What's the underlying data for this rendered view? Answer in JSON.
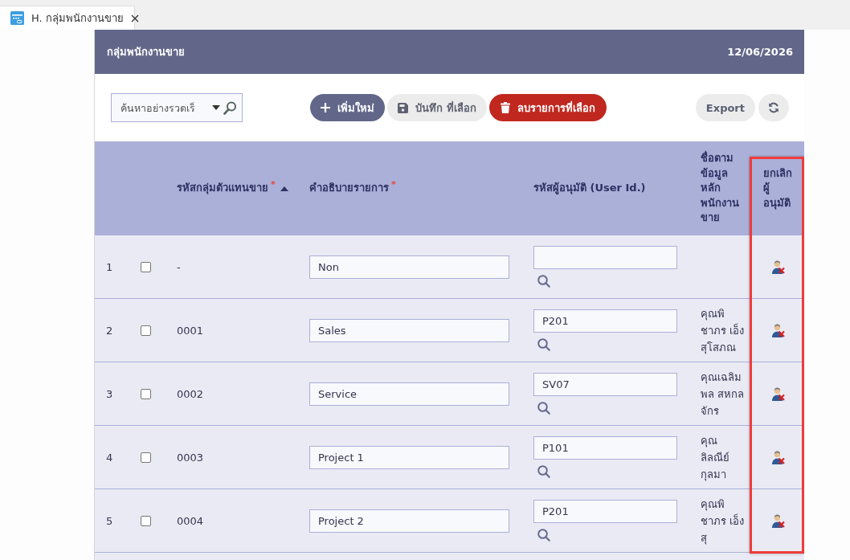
{
  "tab": {
    "label": "H. กลุ่มพนักงานขาย"
  },
  "panel": {
    "title": "กลุ่มพนักงานขาย",
    "date": "12/06/2026"
  },
  "toolbar": {
    "quick_search": {
      "placeholder": "ค้นหาอย่างรวดเร็"
    },
    "actions": [
      {
        "kind": "add",
        "label": "เพิ่มใหม่"
      },
      {
        "kind": "save",
        "label": "บันทึก ที่เลือก"
      },
      {
        "kind": "delete",
        "label": "ลบรายการที่เลือก"
      }
    ],
    "tools": [
      {
        "kind": "export",
        "label": "Export"
      },
      {
        "kind": "refresh"
      }
    ]
  },
  "table": {
    "columns": [
      {
        "kind": "number",
        "sorted": false,
        "highlighted": false
      },
      {
        "kind": "select",
        "sorted": false,
        "highlighted": false
      },
      {
        "kind": "code",
        "label": "รหัสกลุ่มตัวแทนขาย",
        "required_mark": "*",
        "sorted": true,
        "highlighted": false
      },
      {
        "kind": "description",
        "label": "คำอธิบายรายการ",
        "required_mark": "*",
        "sorted": false,
        "highlighted": false
      },
      {
        "kind": "user_id",
        "label": "รหัสผู้อนุมัติ (User Id.)",
        "sorted": false,
        "highlighted": false
      },
      {
        "kind": "name",
        "label": "ชื่อตามข้อมูลหลักพนักงานขาย",
        "sorted": false,
        "highlighted": false
      },
      {
        "kind": "cancel",
        "label": "ยกเลิกผู้อนุมัติ",
        "sorted": false,
        "highlighted": true
      }
    ],
    "rows": [
      {
        "number": "1",
        "checked": false,
        "code": "-",
        "description": "Non"
      },
      {
        "number": "2",
        "checked": false,
        "code": "0001",
        "description": "Sales",
        "user_id": "P201",
        "name": "คุณพิชาภร เอ็งสุโสภณ"
      },
      {
        "number": "3",
        "checked": false,
        "code": "0002",
        "description": "Service",
        "user_id": "SV07",
        "name": "คุณเฉลิมพล สหกลจักร"
      },
      {
        "number": "4",
        "checked": false,
        "code": "0003",
        "description": "Project 1",
        "user_id": "P101",
        "name": "คุณลิลณีย์ กุลมา"
      },
      {
        "number": "5",
        "checked": false,
        "code": "0004",
        "description": "Project 2",
        "user_id": "P201",
        "name": "คุณพิชาภร เอ็งสุ"
      }
    ]
  }
}
